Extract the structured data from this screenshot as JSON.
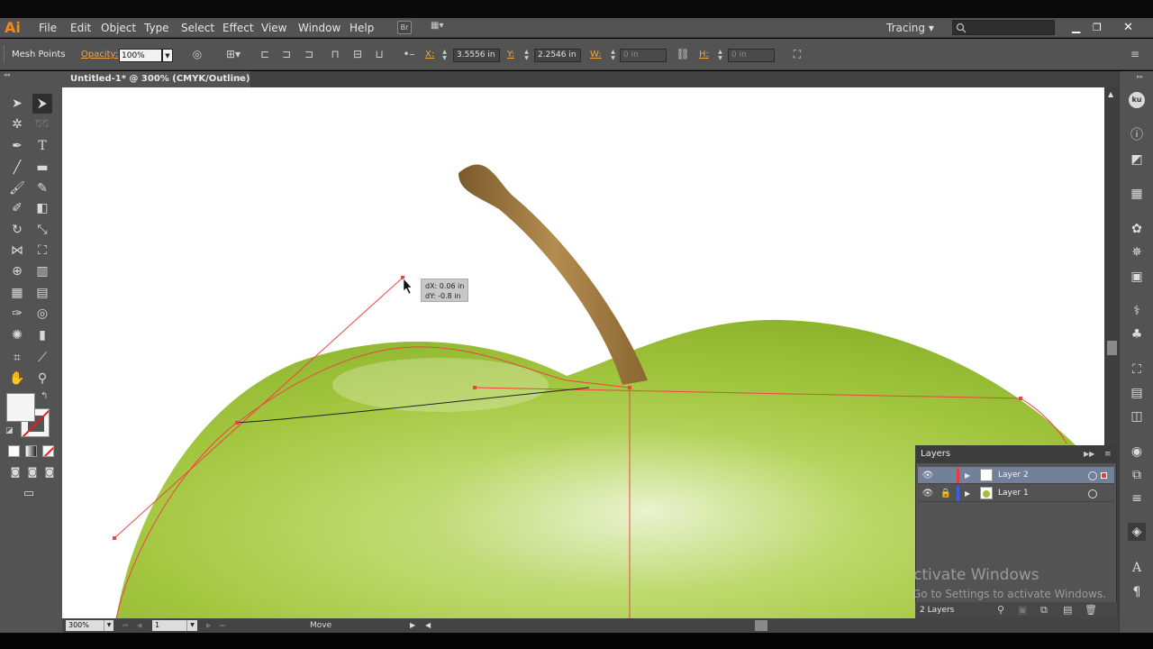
{
  "app": {
    "logo": "Ai"
  },
  "menu": [
    "File",
    "Edit",
    "Object",
    "Type",
    "Select",
    "Effect",
    "View",
    "Window",
    "Help"
  ],
  "menu_extra": {
    "bridge": "Br",
    "workspace": "Tracing ▾"
  },
  "window_controls": {
    "minimize": "▁",
    "maximize": "❐",
    "close": "✕"
  },
  "control_bar": {
    "selection_label": "Mesh Points",
    "opacity_label": "Opacity:",
    "opacity_value": "100%",
    "x_label": "X:",
    "x_value": "3.5556 in",
    "y_label": "Y:",
    "y_value": "2.2546 in",
    "w_label": "W:",
    "w_value": "0 in",
    "h_label": "H:",
    "h_value": "0 in"
  },
  "document": {
    "tab_title": "Untitled-1* @ 300% (CMYK/Outline)",
    "close": "×"
  },
  "canvas": {
    "tooltip_dx": "dX: 0.06 in",
    "tooltip_dy": "dY: -0.8 in"
  },
  "status_bar": {
    "zoom": "300%",
    "page": "1",
    "status": "Move"
  },
  "layers_panel": {
    "title": "Layers",
    "layers": [
      {
        "name": "Layer 2",
        "color": "#e04040",
        "locked": false,
        "selected": true
      },
      {
        "name": "Layer 1",
        "color": "#3f5fe0",
        "locked": true,
        "selected": false
      }
    ],
    "count": "2 Layers"
  },
  "watermark": {
    "line1": "ctivate Windows",
    "line2": "Go to Settings to activate Windows."
  },
  "right_panel_icons": [
    "ku-icon",
    "info-icon",
    "gradient-icon",
    "transparency-icon",
    "swatches-icon",
    "color-guide-icon",
    "symbols-icon",
    "appearance-icon",
    "brushes-icon",
    "graphic-styles-icon",
    "transform-icon",
    "align-icon",
    "pathfinder-icon",
    "stroke-icon",
    "artboards-icon",
    "lines-icon",
    "layers-icon",
    "character-icon",
    "paragraph-icon"
  ],
  "colors": {
    "accent": "#f2a643",
    "selection": "#e04040",
    "ui_bg": "#535353"
  }
}
